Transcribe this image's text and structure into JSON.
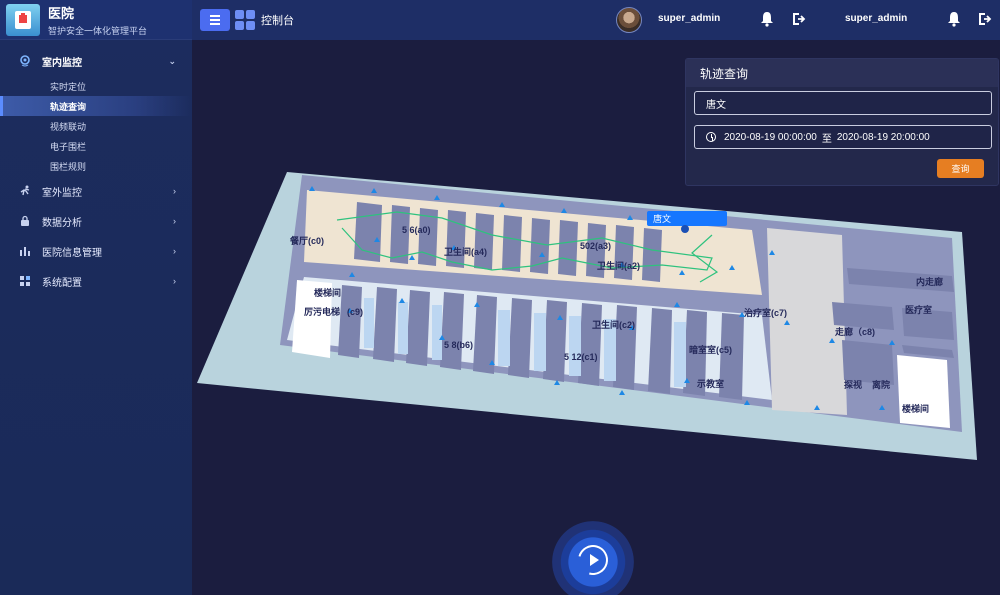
{
  "brand": {
    "title": "医院",
    "subtitle": "智护安全一体化管理平台"
  },
  "topbar": {
    "breadcrumb": "控制台",
    "user1": "super_admin",
    "user2": "super_admin"
  },
  "sidebar": {
    "groups": [
      {
        "label": "室内监控",
        "icon": "location-icon",
        "expanded": true,
        "items": [
          "实时定位",
          "轨迹查询",
          "视频联动",
          "电子围栏",
          "围栏规则"
        ],
        "active": "轨迹查询"
      },
      {
        "label": "室外监控",
        "icon": "running-icon"
      },
      {
        "label": "数据分析",
        "icon": "lock-icon"
      },
      {
        "label": "医院信息管理",
        "icon": "bar-chart-icon"
      },
      {
        "label": "系统配置",
        "icon": "grid-icon"
      }
    ]
  },
  "panel": {
    "title": "轨迹查询",
    "name_value": "唐文",
    "date_start": "2020-08-19 00:00:00",
    "date_sep": "至",
    "date_end": "2020-08-19 20:00:00",
    "query_label": "查询"
  },
  "map": {
    "person_tag": "唐文",
    "rooms": [
      {
        "label": "餐厅(c0)"
      },
      {
        "label": "5  6(a0)"
      },
      {
        "label": "卫生间(a4)"
      },
      {
        "label": "502(a3)"
      },
      {
        "label": "卫生间(a2)"
      },
      {
        "label": "楼梯间"
      },
      {
        "label": "厉污电梯"
      },
      {
        "label": "(c9)"
      },
      {
        "label": "卫生间(c2)"
      },
      {
        "label": "5  8(b6)"
      },
      {
        "label": "5 12(c1)"
      },
      {
        "label": "治疗室(c7)"
      },
      {
        "label": "暗室室(c5)"
      },
      {
        "label": "走廊（c8)"
      },
      {
        "label": "内走廊"
      },
      {
        "label": "医疗室"
      },
      {
        "label": "示教室"
      },
      {
        "label": "探视"
      },
      {
        "label": "离院"
      },
      {
        "label": "楼梯间"
      }
    ]
  },
  "colors": {
    "accent": "#4b6cf0",
    "button": "#e67e22",
    "track": "#2ec27e",
    "background": "#1b1d3f"
  }
}
